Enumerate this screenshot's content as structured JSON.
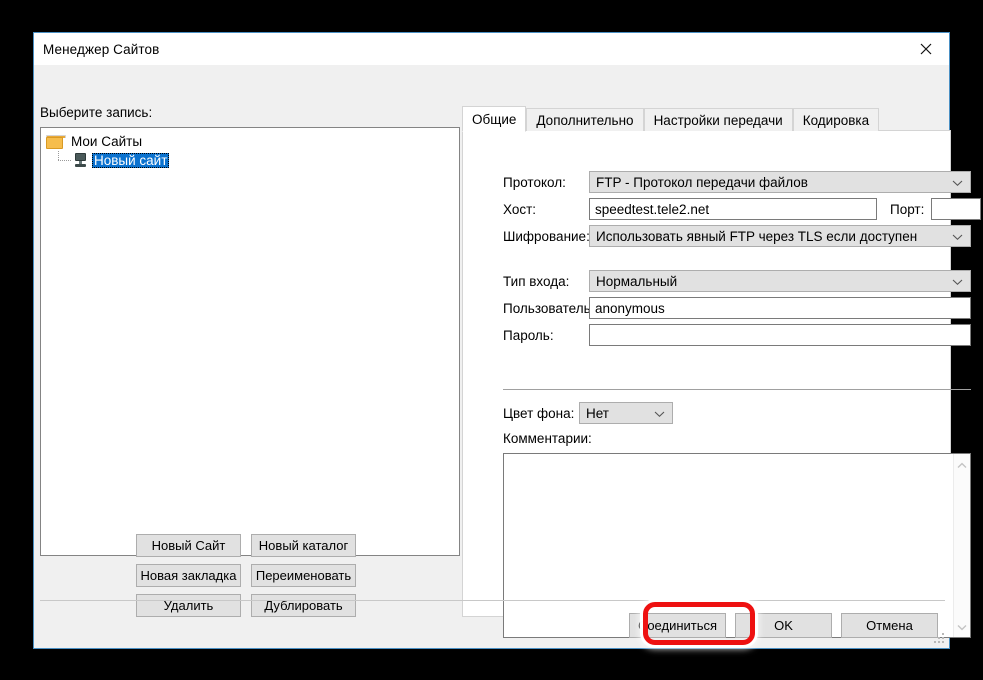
{
  "window": {
    "title": "Менеджер Сайтов",
    "close_icon": "close-icon"
  },
  "left_panel": {
    "select_entry_label": "Выберите запись:",
    "tree": {
      "root": {
        "label": "Мои Сайты",
        "icon": "folder-icon"
      },
      "children": [
        {
          "label": "Новый сайт",
          "icon": "server-icon",
          "selected": true
        }
      ]
    },
    "buttons": [
      {
        "label": "Новый Сайт"
      },
      {
        "label": "Новый каталог"
      },
      {
        "label": "Новая закладка"
      },
      {
        "label": "Переименовать"
      },
      {
        "label": "Удалить"
      },
      {
        "label": "Дублировать"
      }
    ]
  },
  "right_panel": {
    "tabs": [
      {
        "label": "Общие",
        "active": true
      },
      {
        "label": "Дополнительно",
        "active": false
      },
      {
        "label": "Настройки передачи",
        "active": false
      },
      {
        "label": "Кодировка",
        "active": false
      }
    ],
    "fields": {
      "protocol": {
        "label": "Протокол:",
        "value": "FTP - Протокол передачи файлов"
      },
      "host": {
        "label": "Хост:",
        "value": "speedtest.tele2.net",
        "placeholder": ""
      },
      "port": {
        "label": "Порт:",
        "value": "",
        "placeholder": ""
      },
      "encryption": {
        "label": "Шифрование:",
        "value": "Использовать явный FTP через TLS если доступен"
      },
      "logon_type": {
        "label": "Тип входа:",
        "value": "Нормальный"
      },
      "user": {
        "label": "Пользователь:",
        "value": "anonymous",
        "placeholder": ""
      },
      "password": {
        "label": "Пароль:",
        "value": "",
        "placeholder": ""
      },
      "background_color": {
        "label": "Цвет фона:",
        "value": "Нет"
      },
      "comments": {
        "label": "Комментарии:",
        "value": "",
        "placeholder": ""
      }
    }
  },
  "bottom_buttons": [
    {
      "label": "Соединиться",
      "highlighted": true
    },
    {
      "label": "OK",
      "highlighted": false
    },
    {
      "label": "Отмена",
      "highlighted": false
    }
  ],
  "colors": {
    "dialog_bg": "#f0f0f0",
    "dialog_border": "#4a90c4",
    "selection_blue": "#0b72cf",
    "highlight_red": "#ee1111",
    "button_face": "#e1e1e1",
    "folder_yellow": "#f6bd4c"
  }
}
